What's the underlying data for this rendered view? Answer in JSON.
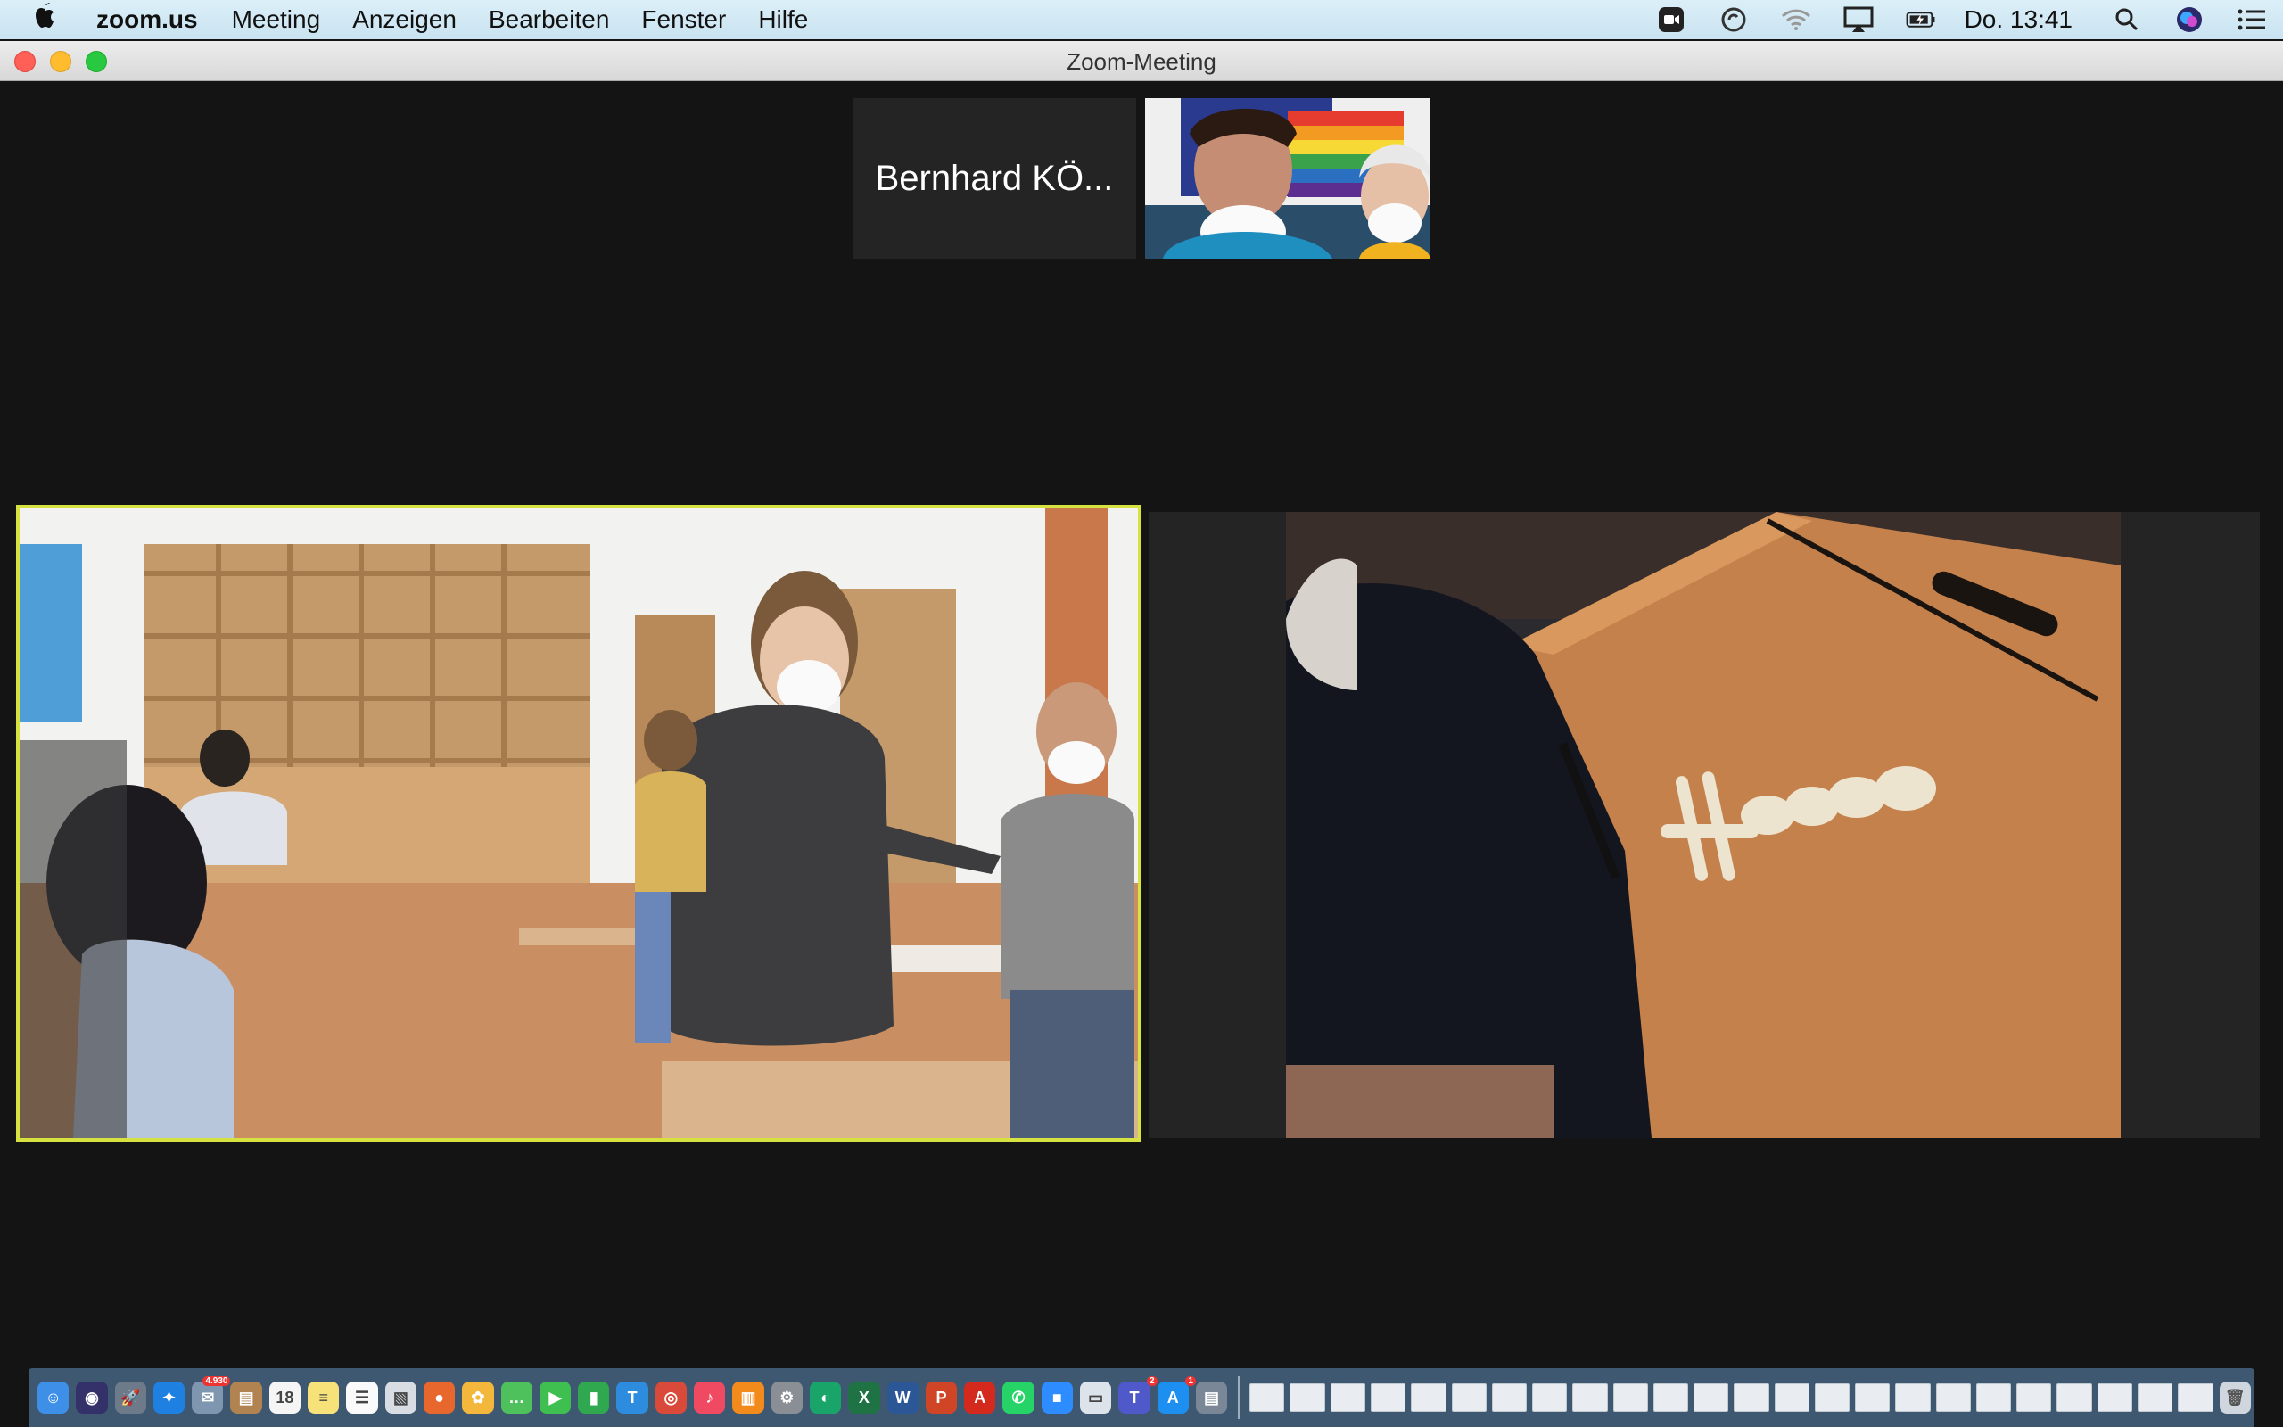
{
  "menubar": {
    "app_name": "zoom.us",
    "menus": [
      "Meeting",
      "Anzeigen",
      "Bearbeiten",
      "Fenster",
      "Hilfe"
    ],
    "clock": "Do. 13:41",
    "status_icons": [
      "zoom-icon",
      "sync-icon",
      "wifi-icon",
      "airplay-icon",
      "battery-icon",
      "search-icon",
      "siri-icon",
      "control-center-icon"
    ]
  },
  "window": {
    "title": "Zoom-Meeting"
  },
  "participants": {
    "thumbnail_name": "Bernhard KÖ..."
  },
  "dock": {
    "apps": [
      {
        "icon": "finder-icon",
        "color": "#3d8fe8",
        "glyph": "☺"
      },
      {
        "icon": "siri-icon",
        "color": "#34306a",
        "glyph": "◉"
      },
      {
        "icon": "launchpad-icon",
        "color": "#6d7a8a",
        "glyph": "🚀"
      },
      {
        "icon": "safari-icon",
        "color": "#1e80e0",
        "glyph": "✦"
      },
      {
        "icon": "mail-icon",
        "color": "#7f96b0",
        "glyph": "✉",
        "badge": "4.930"
      },
      {
        "icon": "contacts-icon",
        "color": "#b08350",
        "glyph": "▤"
      },
      {
        "icon": "calendar-icon",
        "color": "#f5f5f5",
        "glyph": "18"
      },
      {
        "icon": "notes-icon",
        "color": "#f7e27a",
        "glyph": "≡"
      },
      {
        "icon": "reminders-icon",
        "color": "#fafafa",
        "glyph": "☰"
      },
      {
        "icon": "preview-icon",
        "color": "#d8dde3",
        "glyph": "▧"
      },
      {
        "icon": "firefox-icon",
        "color": "#e8672c",
        "glyph": "●"
      },
      {
        "icon": "photos-icon",
        "color": "#f3b73c",
        "glyph": "✿"
      },
      {
        "icon": "messages-icon",
        "color": "#4ec15c",
        "glyph": "…"
      },
      {
        "icon": "facetime-icon",
        "color": "#3fbf50",
        "glyph": "▶"
      },
      {
        "icon": "numbers-icon",
        "color": "#2fa84f",
        "glyph": "▮"
      },
      {
        "icon": "keynote-icon",
        "color": "#2d8cde",
        "glyph": "T"
      },
      {
        "icon": "chrome-icon",
        "color": "#d94a3a",
        "glyph": "◎"
      },
      {
        "icon": "music-icon",
        "color": "#f04a62",
        "glyph": "♪"
      },
      {
        "icon": "books-icon",
        "color": "#f28a1c",
        "glyph": "▥"
      },
      {
        "icon": "system-preferences-icon",
        "color": "#8a8f96",
        "glyph": "⚙"
      },
      {
        "icon": "browser-icon",
        "color": "#19a56a",
        "glyph": "◐"
      },
      {
        "icon": "excel-icon",
        "color": "#1f7244",
        "glyph": "X"
      },
      {
        "icon": "word-icon",
        "color": "#2b5797",
        "glyph": "W"
      },
      {
        "icon": "powerpoint-icon",
        "color": "#d04525",
        "glyph": "P"
      },
      {
        "icon": "acrobat-icon",
        "color": "#d42a1e",
        "glyph": "A"
      },
      {
        "icon": "whatsapp-icon",
        "color": "#25d366",
        "glyph": "✆"
      },
      {
        "icon": "zoom-icon",
        "color": "#2d8cff",
        "glyph": "■"
      },
      {
        "icon": "preview-stack-icon",
        "color": "#dde3ea",
        "glyph": "▭"
      },
      {
        "icon": "teams-icon",
        "color": "#5059c9",
        "glyph": "T",
        "badge": "2"
      },
      {
        "icon": "app-store-icon",
        "color": "#1c8ff0",
        "glyph": "A",
        "badge": "1"
      },
      {
        "icon": "scanner-icon",
        "color": "#7a8796",
        "glyph": "▤"
      }
    ],
    "window_count": 24
  }
}
